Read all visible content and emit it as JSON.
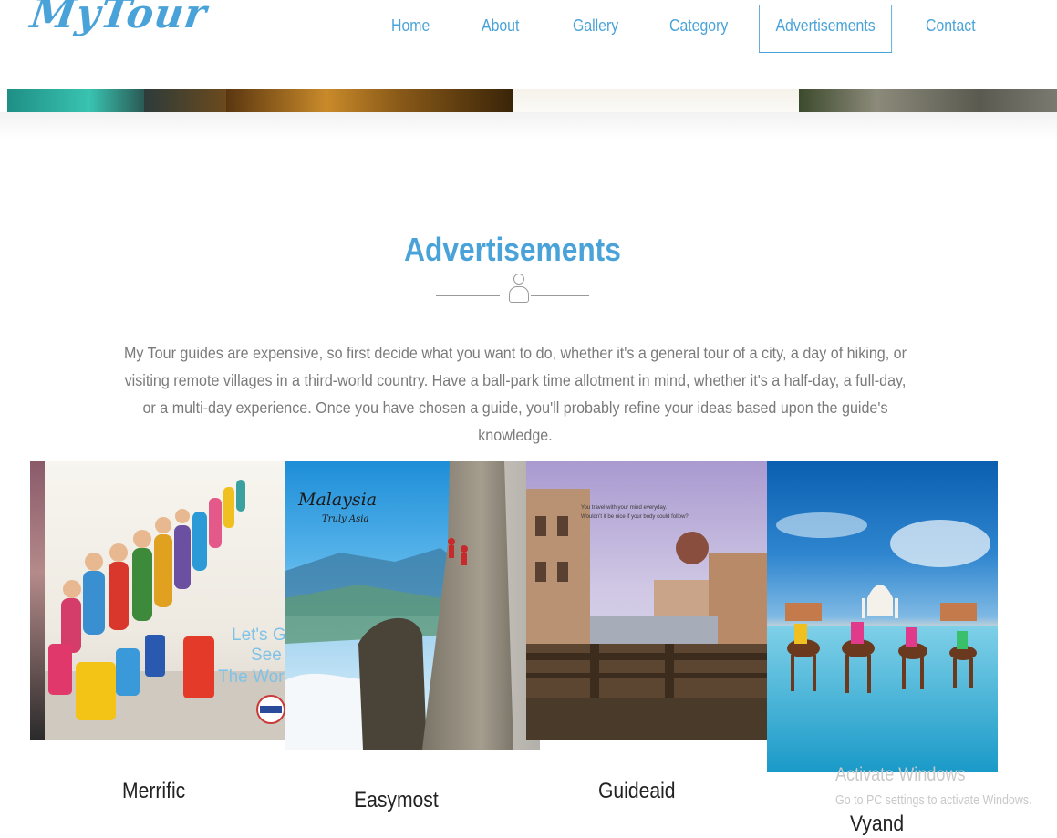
{
  "brand": {
    "logo_text": "MyTour"
  },
  "nav": {
    "items": [
      {
        "label": "Home"
      },
      {
        "label": "About"
      },
      {
        "label": "Gallery"
      },
      {
        "label": "Category"
      },
      {
        "label": "Advertisements",
        "active": true
      },
      {
        "label": "Contact"
      }
    ]
  },
  "section": {
    "title": "Advertisements",
    "intro": "My Tour guides are expensive, so first decide what you want to do, whether it's a general tour of a city, a day of hiking, or visiting remote villages in a third-world country. Have a ball-park time allotment in mind, whether it's a half-day, a full-day, or a multi-day experience. Once you have chosen a guide, you'll probably refine your ideas based upon the guide's knowledge."
  },
  "cards": [
    {
      "name": "Merrific",
      "ad_text": "Let's Go See The World"
    },
    {
      "name": "Easymost",
      "ad_text": "Malaysia Truly Asia"
    },
    {
      "name": "Guideaid",
      "ad_text": "You travel with your mind everyday. Wouldn't it be nice if your body could follow?"
    },
    {
      "name": "Vyand",
      "ad_text": ""
    }
  ],
  "watermark": {
    "line1": "Activate Windows",
    "line2": "Go to PC settings to activate Windows."
  },
  "colors": {
    "accent": "#4aa3d8",
    "body_text": "#7a7a7a",
    "label_text": "#222222"
  }
}
